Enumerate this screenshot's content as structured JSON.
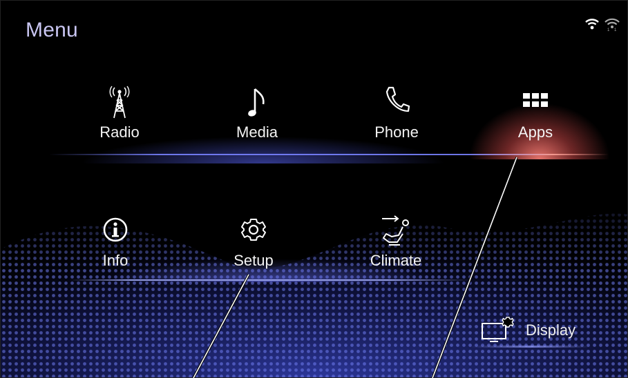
{
  "header": {
    "title": "Menu"
  },
  "status": {
    "wifi_icon": "wifi-icon",
    "signal_icon": "wireless-signal-icon"
  },
  "menu_row1": [
    {
      "label": "Radio",
      "icon": "radio-tower-icon"
    },
    {
      "label": "Media",
      "icon": "music-note-icon"
    },
    {
      "label": "Phone",
      "icon": "phone-handset-icon"
    },
    {
      "label": "Apps",
      "icon": "apps-grid-icon",
      "selected": true
    }
  ],
  "menu_row2": [
    {
      "label": "Info",
      "icon": "info-icon"
    },
    {
      "label": "Setup",
      "icon": "gear-icon"
    },
    {
      "label": "Climate",
      "icon": "climate-seat-icon"
    }
  ],
  "display_button": {
    "label": "Display",
    "icon": "display-settings-icon"
  },
  "colors": {
    "background": "#000000",
    "title": "#c9c6f2",
    "selected_glow": "#e0706a",
    "blue_glow": "#5a66ff",
    "wave": "#3f4fd0"
  }
}
